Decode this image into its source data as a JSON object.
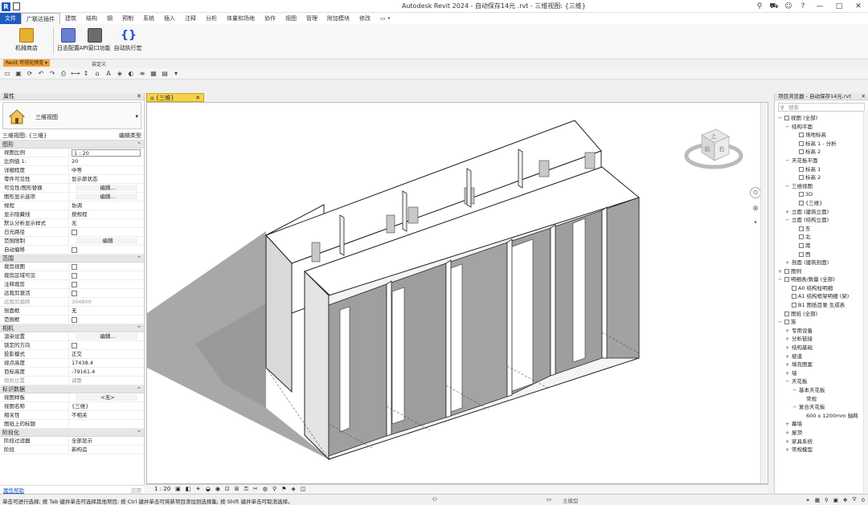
{
  "window": {
    "title": "Autodesk Revit 2024 - 自动保存14元 .rvt - 三维视图: {三维}",
    "controls": [
      "—",
      "□",
      "✕"
    ]
  },
  "ribbon": {
    "tabs": [
      "文件",
      "广联达插件",
      "建筑",
      "结构",
      "钢",
      "预制",
      "系统",
      "插入",
      "注释",
      "分析",
      "体量和场地",
      "协作",
      "视图",
      "管理",
      "附加模块",
      "修改",
      "▭ •"
    ],
    "buttons": [
      {
        "label": "机械商店",
        "icon": "gift-icon"
      },
      {
        "label": "日志配置",
        "icon": "document-icon"
      },
      {
        "label": "API窗口功能",
        "icon": "code-window-icon"
      },
      {
        "label": "自动执行宏",
        "icon": "braces-icon"
      }
    ],
    "panel_dropdown": "Revit 可视化预览 ▾",
    "panel_label": "自定义"
  },
  "properties": {
    "header": "属性",
    "close": "✕",
    "type_name": "三维视图",
    "view_selector": "三维视图: {三维}",
    "edit_type": "编辑类型",
    "groups": [
      {
        "name": "图形",
        "rows": [
          {
            "k": "视图比例",
            "v": "1 : 20",
            "style": "edit"
          },
          {
            "k": "比例值 1:",
            "v": "20"
          },
          {
            "k": "详细程度",
            "v": "中等"
          },
          {
            "k": "零件可见性",
            "v": "显示原状态"
          },
          {
            "k": "可见性/图形替换",
            "v": "编辑...",
            "style": "btn"
          },
          {
            "k": "图形显示选项",
            "v": "编辑...",
            "style": "btn"
          },
          {
            "k": "规程",
            "v": "协调"
          },
          {
            "k": "显示隐藏线",
            "v": "按规程"
          },
          {
            "k": "默认分析显示样式",
            "v": "无"
          },
          {
            "k": "日光路径",
            "v": "",
            "style": "cb"
          },
          {
            "k": "范围限制",
            "v": "编辑",
            "style": "btn"
          },
          {
            "k": "自动偏移",
            "v": "",
            "style": "cb"
          }
        ]
      },
      {
        "name": "范围",
        "rows": [
          {
            "k": "裁剪视图",
            "v": "",
            "style": "cb"
          },
          {
            "k": "裁剪区域可见",
            "v": "",
            "style": "cb"
          },
          {
            "k": "注释裁剪",
            "v": "",
            "style": "cb"
          },
          {
            "k": "远裁剪激活",
            "v": "",
            "style": "cb"
          },
          {
            "k": "远裁剪偏移",
            "v": "304800",
            "style": "dim"
          },
          {
            "k": "剖面框",
            "v": "无"
          },
          {
            "k": "范围框",
            "v": "",
            "style": "cb"
          }
        ]
      },
      {
        "name": "相机",
        "rows": [
          {
            "k": "渲染设置",
            "v": "编辑...",
            "style": "btn"
          },
          {
            "k": "锁定的方向",
            "v": "",
            "style": "cb"
          },
          {
            "k": "投影模式",
            "v": "正交"
          },
          {
            "k": "视点高度",
            "v": "17438.4"
          },
          {
            "k": "目标高度",
            "v": "-79161.4"
          },
          {
            "k": "相机位置",
            "v": "调整",
            "style": "dim"
          }
        ]
      },
      {
        "name": "标识数据",
        "rows": [
          {
            "k": "视图样板",
            "v": "<无>",
            "style": "btn"
          },
          {
            "k": "视图名称",
            "v": "{三维}"
          },
          {
            "k": "相关性",
            "v": "不相关"
          },
          {
            "k": "图纸上的标题",
            "v": ""
          }
        ]
      },
      {
        "name": "阶段化",
        "rows": [
          {
            "k": "阶段过滤器",
            "v": "全部显示"
          },
          {
            "k": "阶段",
            "v": "新构造"
          }
        ]
      }
    ],
    "help_link": "属性帮助",
    "apply": "应用"
  },
  "view": {
    "tab_label": "{三维}",
    "tab_close": "✕",
    "scale": "1 : 20",
    "viewcube_labels": [
      "上",
      "前",
      "右"
    ]
  },
  "project_browser": {
    "header": "项目浏览器 - 自动保存14元.rvt",
    "close": "✕",
    "search_placeholder": "搜索",
    "tree": [
      {
        "d": 0,
        "pm": "−",
        "sq": true,
        "label": "视图 (全部)"
      },
      {
        "d": 1,
        "pm": "−",
        "sq": false,
        "label": "结构平面"
      },
      {
        "d": 2,
        "pm": "",
        "sq": true,
        "label": "场地标高"
      },
      {
        "d": 2,
        "pm": "",
        "sq": true,
        "label": "标高 1 - 分析"
      },
      {
        "d": 2,
        "pm": "",
        "sq": true,
        "label": "标高 2"
      },
      {
        "d": 1,
        "pm": "−",
        "sq": false,
        "label": "天花板平面"
      },
      {
        "d": 2,
        "pm": "",
        "sq": true,
        "label": "标高 1"
      },
      {
        "d": 2,
        "pm": "",
        "sq": true,
        "label": "标高 2"
      },
      {
        "d": 1,
        "pm": "−",
        "sq": false,
        "label": "三维视图"
      },
      {
        "d": 2,
        "pm": "",
        "sq": true,
        "label": "3D"
      },
      {
        "d": 2,
        "pm": "",
        "sq": true,
        "label": "{三维}"
      },
      {
        "d": 1,
        "pm": "+",
        "sq": false,
        "label": "立面 (建筑立面)"
      },
      {
        "d": 1,
        "pm": "−",
        "sq": false,
        "label": "立面 (结构立面)"
      },
      {
        "d": 2,
        "pm": "",
        "sq": true,
        "label": "东"
      },
      {
        "d": 2,
        "pm": "",
        "sq": true,
        "label": "北"
      },
      {
        "d": 2,
        "pm": "",
        "sq": true,
        "label": "南"
      },
      {
        "d": 2,
        "pm": "",
        "sq": true,
        "label": "西"
      },
      {
        "d": 1,
        "pm": "+",
        "sq": false,
        "label": "剖面 (建筑剖面)"
      },
      {
        "d": 0,
        "pm": "+",
        "sq": true,
        "label": "图例"
      },
      {
        "d": 0,
        "pm": "−",
        "sq": true,
        "label": "明细表/数量 (全部)"
      },
      {
        "d": 1,
        "pm": "",
        "sq": true,
        "label": "A0 结构柱明细"
      },
      {
        "d": 1,
        "pm": "",
        "sq": true,
        "label": "A1 结构框架明细 (梁)"
      },
      {
        "d": 1,
        "pm": "",
        "sq": true,
        "label": "B1 图纸目录 生成表"
      },
      {
        "d": 0,
        "pm": "",
        "sq": true,
        "label": "图纸 (全部)"
      },
      {
        "d": 0,
        "pm": "−",
        "sq": true,
        "label": "族"
      },
      {
        "d": 1,
        "pm": "+",
        "sq": false,
        "label": "专用设备"
      },
      {
        "d": 1,
        "pm": "+",
        "sq": false,
        "label": "分析链接"
      },
      {
        "d": 1,
        "pm": "+",
        "sq": false,
        "label": "结构基础"
      },
      {
        "d": 1,
        "pm": "+",
        "sq": false,
        "label": "坡道"
      },
      {
        "d": 1,
        "pm": "+",
        "sq": false,
        "label": "填充图案"
      },
      {
        "d": 1,
        "pm": "+",
        "sq": false,
        "label": "墙"
      },
      {
        "d": 1,
        "pm": "−",
        "sq": false,
        "label": "天花板"
      },
      {
        "d": 2,
        "pm": "−",
        "sq": false,
        "label": "基本天花板"
      },
      {
        "d": 3,
        "pm": "",
        "sq": false,
        "label": "常规"
      },
      {
        "d": 2,
        "pm": "−",
        "sq": false,
        "label": "复合天花板"
      },
      {
        "d": 3,
        "pm": "",
        "sq": false,
        "label": "600 x 1200mm 轴网"
      },
      {
        "d": 1,
        "pm": "+",
        "sq": false,
        "label": "幕墙"
      },
      {
        "d": 1,
        "pm": "+",
        "sq": false,
        "label": "屋顶"
      },
      {
        "d": 1,
        "pm": "+",
        "sq": false,
        "label": "家具系统"
      },
      {
        "d": 1,
        "pm": "+",
        "sq": false,
        "label": "常规模型"
      }
    ]
  },
  "statusbar": {
    "hint": "单击可进行选择; 按 Tab 键并单击可选择其他项目; 按 Ctrl 键并单击可将新项目添加到选择集; 按 Shift 键并单击可取消选择。",
    "model": "主模型",
    "filter": "0"
  }
}
